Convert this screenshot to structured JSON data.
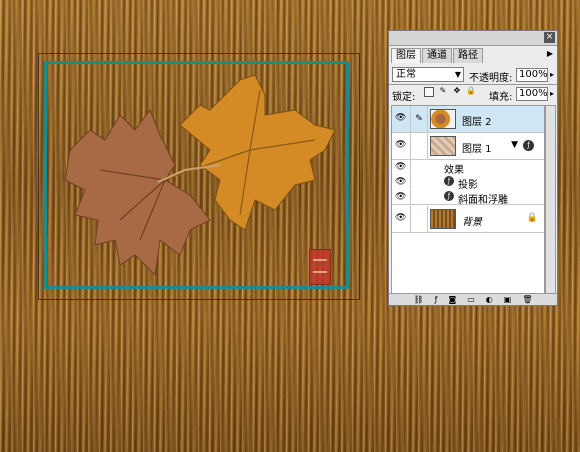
{
  "panel": {
    "close_icon": "close-icon",
    "tabs": [
      {
        "label": "图层",
        "active": true
      },
      {
        "label": "通道",
        "active": false
      },
      {
        "label": "路径",
        "active": false
      }
    ],
    "menu_icon": "panel-menu-arrow-icon",
    "blend_mode": "正常",
    "opacity_label": "不透明度:",
    "opacity_value": "100%",
    "lock_label": "锁定:",
    "fill_label": "填充:",
    "fill_value": "100%",
    "layers": [
      {
        "name": "图层 2",
        "selected": true
      },
      {
        "name": "图层 1",
        "selected": false
      },
      {
        "name": "背景",
        "selected": false
      }
    ],
    "effects_label": "效果",
    "effects": [
      "投影",
      "斜面和浮雕"
    ]
  }
}
